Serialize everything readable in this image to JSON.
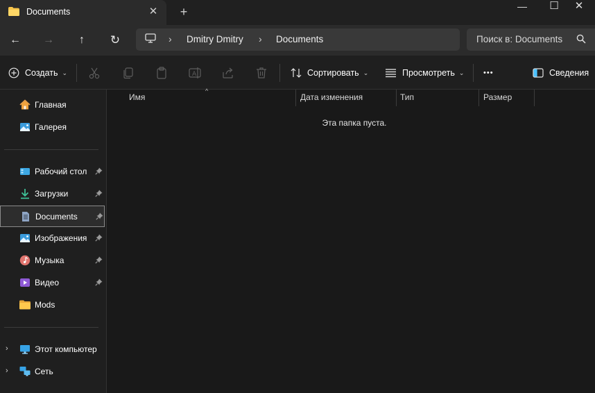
{
  "window": {
    "tab_title": "Documents",
    "tab_close": "✕",
    "new_tab": "+",
    "minimize": "—",
    "maximize": "☐",
    "close": "✕"
  },
  "nav": {
    "back": "←",
    "forward": "→",
    "up": "↑",
    "refresh": "↻"
  },
  "breadcrumb": {
    "chevron": "›",
    "items": [
      "Dmitry Dmitry",
      "Documents"
    ]
  },
  "search": {
    "placeholder": "Поиск в: Documents"
  },
  "commandbar": {
    "new_label": "Создать",
    "sort_label": "Сортировать",
    "view_label": "Просмотреть",
    "more_label": "•••",
    "details_label": "Сведения",
    "chevron": "⌄"
  },
  "sidebar": {
    "quick": [
      {
        "label": "Главная",
        "icon": "home-icon"
      },
      {
        "label": "Галерея",
        "icon": "gallery-icon"
      }
    ],
    "pinned": [
      {
        "label": "Рабочий стол",
        "icon": "desktop-folder-icon",
        "pinned": true
      },
      {
        "label": "Загрузки",
        "icon": "downloads-icon",
        "pinned": true
      },
      {
        "label": "Documents",
        "icon": "documents-icon",
        "pinned": true,
        "selected": true
      },
      {
        "label": "Изображения",
        "icon": "pictures-icon",
        "pinned": true
      },
      {
        "label": "Музыка",
        "icon": "music-icon",
        "pinned": true
      },
      {
        "label": "Видео",
        "icon": "video-icon",
        "pinned": true
      },
      {
        "label": "Mods",
        "icon": "folder-icon",
        "pinned": false
      }
    ],
    "system": [
      {
        "label": "Этот компьютер",
        "icon": "this-pc-icon"
      },
      {
        "label": "Сеть",
        "icon": "network-icon"
      }
    ],
    "expand_glyph": "›"
  },
  "columns": {
    "name": "Имя",
    "date": "Дата изменения",
    "type": "Тип",
    "size": "Размер"
  },
  "content": {
    "empty_message": "Эта папка пуста."
  },
  "colors": {
    "background": "#191919",
    "titlebar": "#202020",
    "addressbar": "#2b2b2b",
    "input": "#393939",
    "folder": "#f8c54b",
    "accent": "#4cc2ff"
  }
}
